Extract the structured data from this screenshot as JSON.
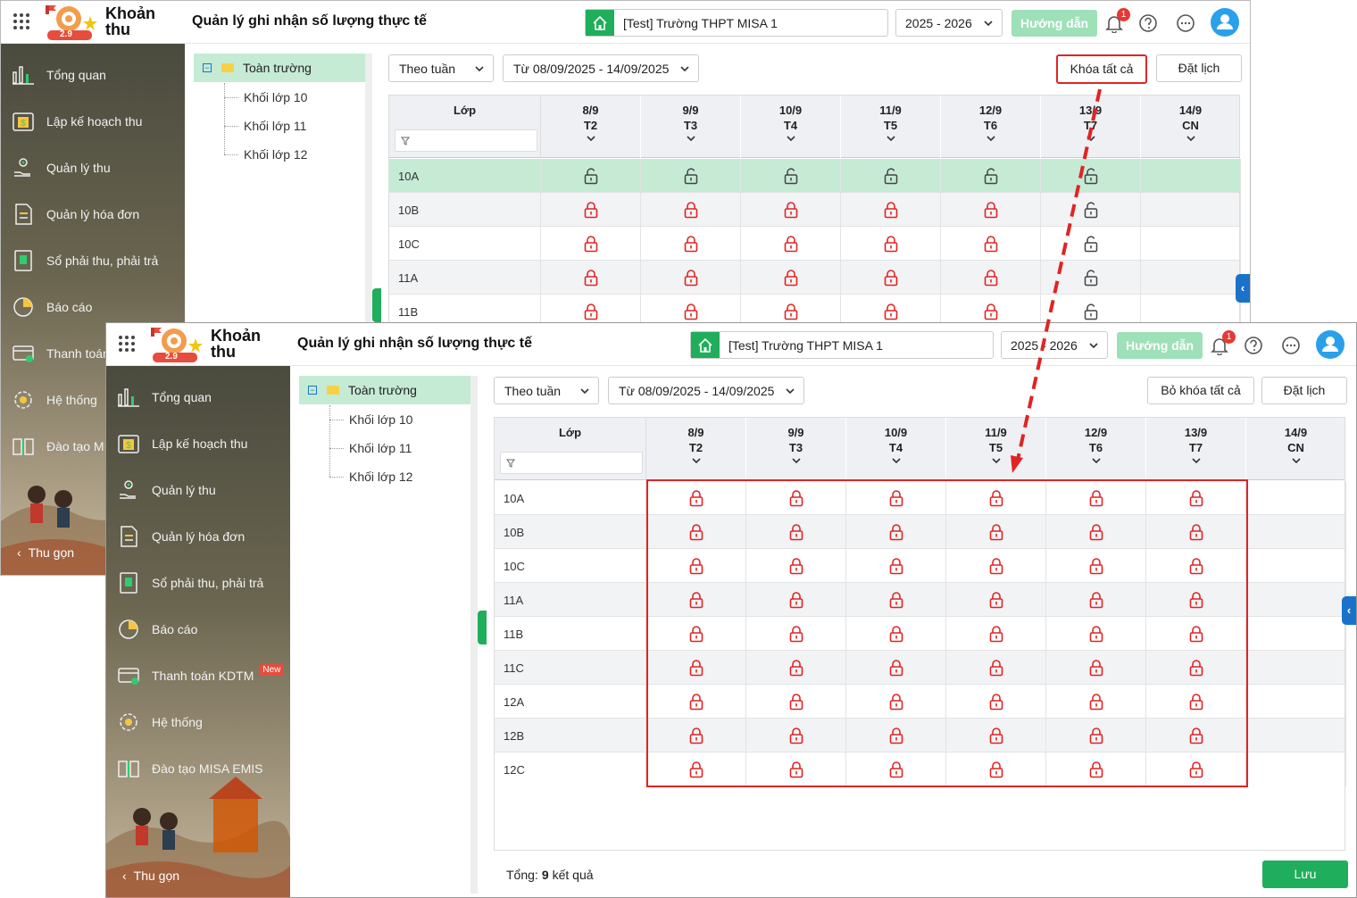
{
  "app": {
    "name": "Khoản thu",
    "logo_text": "2.9"
  },
  "page_title": "Quản lý ghi nhận số lượng thực tế",
  "school": "[Test] Trường THPT MISA 1",
  "year": "2025 - 2026",
  "guide_label": "Hướng dẫn",
  "notifications": "1",
  "sidebar": {
    "items": [
      {
        "label": "Tổng quan",
        "icon": "bar-chart-icon"
      },
      {
        "label": "Lập kế hoạch thu",
        "icon": "calendar-money-icon"
      },
      {
        "label": "Quản lý thu",
        "icon": "hand-coin-icon"
      },
      {
        "label": "Quản lý hóa đơn",
        "icon": "invoice-icon"
      },
      {
        "label": "Sổ phải thu, phải trả",
        "icon": "ledger-book-icon"
      },
      {
        "label": "Báo cáo",
        "icon": "pie-chart-icon"
      },
      {
        "label": "Thanh toán KDTM",
        "icon": "card-payment-icon",
        "badge": "New"
      },
      {
        "label": "Hệ thống",
        "icon": "gear-icon"
      },
      {
        "label": "Đào tạo MISA EMIS",
        "icon": "open-book-icon"
      }
    ],
    "back_w1": {
      "thanh_toan": "Thanh toán",
      "dao_tao": "Đào tạo MI"
    },
    "collapse": "Thu gọn"
  },
  "tree": {
    "root": "Toàn trường",
    "children": [
      "Khối lớp 10",
      "Khối lớp 11",
      "Khối lớp 12"
    ]
  },
  "toolbar": {
    "mode": "Theo tuần",
    "range": "Từ 08/09/2025 - 14/09/2025",
    "lock_all": "Khóa tất cả",
    "unlock_all": "Bỏ khóa tất cả",
    "schedule": "Đặt lịch"
  },
  "table": {
    "class_header": "Lớp",
    "days": [
      {
        "date": "8/9",
        "dow": "T2"
      },
      {
        "date": "9/9",
        "dow": "T3"
      },
      {
        "date": "10/9",
        "dow": "T4"
      },
      {
        "date": "11/9",
        "dow": "T5"
      },
      {
        "date": "12/9",
        "dow": "T6"
      },
      {
        "date": "13/9",
        "dow": "T7"
      },
      {
        "date": "14/9",
        "dow": "CN"
      }
    ],
    "back_rows": [
      {
        "name": "10A",
        "cells": [
          "unlocked",
          "unlocked",
          "unlocked",
          "unlocked",
          "unlocked",
          "unlocked",
          ""
        ]
      },
      {
        "name": "10B",
        "cells": [
          "locked",
          "locked",
          "locked",
          "locked",
          "locked",
          "unlocked",
          ""
        ]
      },
      {
        "name": "10C",
        "cells": [
          "locked",
          "locked",
          "locked",
          "locked",
          "locked",
          "unlocked",
          ""
        ]
      },
      {
        "name": "11A",
        "cells": [
          "locked",
          "locked",
          "locked",
          "locked",
          "locked",
          "unlocked",
          ""
        ]
      },
      {
        "name": "11B",
        "cells": [
          "locked",
          "locked",
          "locked",
          "locked",
          "locked",
          "unlocked",
          ""
        ]
      }
    ],
    "front_rows": [
      {
        "name": "10A",
        "cells": [
          "locked",
          "locked",
          "locked",
          "locked",
          "locked",
          "locked",
          ""
        ]
      },
      {
        "name": "10B",
        "cells": [
          "locked",
          "locked",
          "locked",
          "locked",
          "locked",
          "locked",
          ""
        ]
      },
      {
        "name": "10C",
        "cells": [
          "locked",
          "locked",
          "locked",
          "locked",
          "locked",
          "locked",
          ""
        ]
      },
      {
        "name": "11A",
        "cells": [
          "locked",
          "locked",
          "locked",
          "locked",
          "locked",
          "locked",
          ""
        ]
      },
      {
        "name": "11B",
        "cells": [
          "locked",
          "locked",
          "locked",
          "locked",
          "locked",
          "locked",
          ""
        ]
      },
      {
        "name": "11C",
        "cells": [
          "locked",
          "locked",
          "locked",
          "locked",
          "locked",
          "locked",
          ""
        ]
      },
      {
        "name": "12A",
        "cells": [
          "locked",
          "locked",
          "locked",
          "locked",
          "locked",
          "locked",
          ""
        ]
      },
      {
        "name": "12B",
        "cells": [
          "locked",
          "locked",
          "locked",
          "locked",
          "locked",
          "locked",
          ""
        ]
      },
      {
        "name": "12C",
        "cells": [
          "locked",
          "locked",
          "locked",
          "locked",
          "locked",
          "locked",
          ""
        ]
      }
    ]
  },
  "footer": {
    "total_label": "Tổng:",
    "total_count": "9",
    "total_suffix": "kết quả",
    "save": "Lưu"
  },
  "colors": {
    "primary": "#1fae5b",
    "lock": "#e02424",
    "highlight": "#e02424",
    "selected_row": "#c5ebd5"
  }
}
